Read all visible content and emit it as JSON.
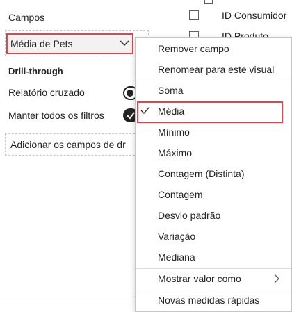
{
  "fields_pane": {
    "section_label": "Campos",
    "field_value": "Média de Pets",
    "drill_through_title": "Drill-through",
    "cross_report_label": "Relatório cruzado",
    "cross_report_state": "off",
    "keep_filters_label": "Manter todos os filtros",
    "keep_filters_state": "on",
    "drill_well_placeholder": "Adicionar os campos de dr"
  },
  "fields_list": {
    "items": [
      {
        "label": "ID Consumidor",
        "checked": false
      },
      {
        "label": "ID Produto",
        "checked": false
      }
    ]
  },
  "context_menu": {
    "items": [
      {
        "label": "Remover campo"
      },
      {
        "label": "Renomear para este visual"
      },
      {
        "label": "Soma"
      },
      {
        "label": "Média",
        "selected": true
      },
      {
        "label": "Mínimo"
      },
      {
        "label": "Máximo"
      },
      {
        "label": "Contagem (Distinta)"
      },
      {
        "label": "Contagem"
      },
      {
        "label": "Desvio padrão"
      },
      {
        "label": "Variação"
      },
      {
        "label": "Mediana"
      },
      {
        "label": "Mostrar valor como",
        "has_submenu": true
      },
      {
        "label": "Novas medidas rápidas"
      }
    ]
  },
  "colors": {
    "highlight": "#e0454d",
    "text": "#252423",
    "border": "#c8c6c4"
  }
}
